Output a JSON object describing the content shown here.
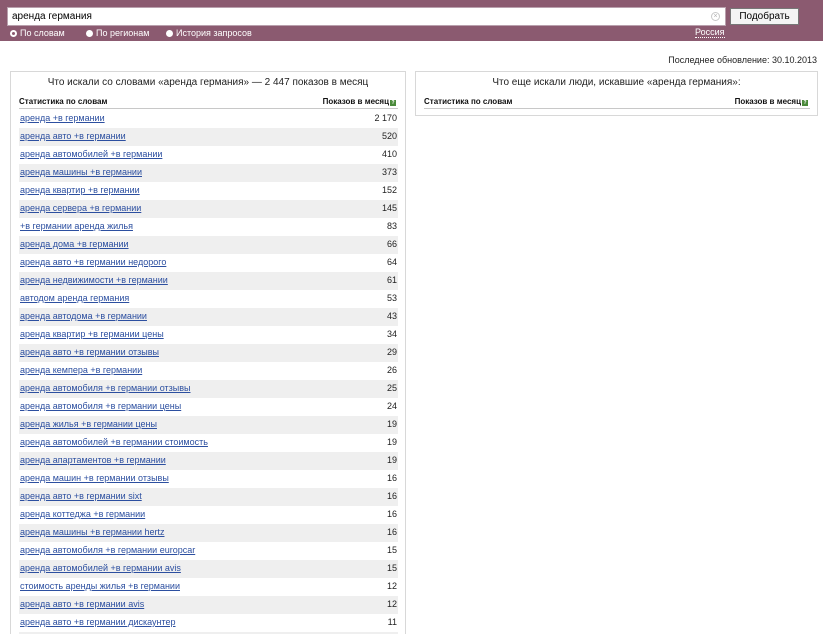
{
  "search": {
    "query": "аренда германия",
    "clear_symbol": "×",
    "button_label": "Подобрать"
  },
  "modes": [
    {
      "label": "По словам",
      "selected": true
    },
    {
      "label": "По регионам",
      "selected": false
    },
    {
      "label": "История запросов",
      "selected": false
    }
  ],
  "region": "Россия",
  "last_update": "Последнее обновление: 30.10.2013",
  "left_panel": {
    "title": "Что искали со словами «аренда германия» — 2 447 показов в месяц",
    "col_stats": "Статистика по словам",
    "col_shows": "Показов в месяц",
    "help_mark": "?",
    "rows": [
      {
        "keyword": "аренда +в германии",
        "count": "2 170"
      },
      {
        "keyword": "аренда авто +в германии",
        "count": "520"
      },
      {
        "keyword": "аренда автомобилей +в германии",
        "count": "410"
      },
      {
        "keyword": "аренда машины +в германии",
        "count": "373"
      },
      {
        "keyword": "аренда квартир +в германии",
        "count": "152"
      },
      {
        "keyword": "аренда сервера +в германии",
        "count": "145"
      },
      {
        "keyword": "+в германии аренда жилья",
        "count": "83"
      },
      {
        "keyword": "аренда дома +в германии",
        "count": "66"
      },
      {
        "keyword": "аренда авто +в германии недорого",
        "count": "64"
      },
      {
        "keyword": "аренда недвижимости +в германии",
        "count": "61"
      },
      {
        "keyword": "автодом аренда германия",
        "count": "53"
      },
      {
        "keyword": "аренда автодома +в германии",
        "count": "43"
      },
      {
        "keyword": "аренда квартир +в германии цены",
        "count": "34"
      },
      {
        "keyword": "аренда авто +в германии отзывы",
        "count": "29"
      },
      {
        "keyword": "аренда кемпера +в германии",
        "count": "26"
      },
      {
        "keyword": "аренда автомобиля +в германии отзывы",
        "count": "25"
      },
      {
        "keyword": "аренда автомобиля +в германии цены",
        "count": "24"
      },
      {
        "keyword": "аренда жилья +в германии цены",
        "count": "19"
      },
      {
        "keyword": "аренда автомобилей +в германии стоимость",
        "count": "19"
      },
      {
        "keyword": "аренда апартаментов +в германии",
        "count": "19"
      },
      {
        "keyword": "аренда машин +в германии отзывы",
        "count": "16"
      },
      {
        "keyword": "аренда авто +в германии sixt",
        "count": "16"
      },
      {
        "keyword": "аренда коттеджа +в германии",
        "count": "16"
      },
      {
        "keyword": "аренда машины +в германии hertz",
        "count": "16"
      },
      {
        "keyword": "аренда автомобиля +в германии europcar",
        "count": "15"
      },
      {
        "keyword": "аренда автомобилей +в германии avis",
        "count": "15"
      },
      {
        "keyword": "стоимость аренды жилья +в германии",
        "count": "12"
      },
      {
        "keyword": "аренда авто +в германии avis",
        "count": "12"
      },
      {
        "keyword": "аренда авто +в германии дискаунтер",
        "count": "11"
      },
      {
        "keyword": "",
        "count": ""
      }
    ]
  },
  "right_panel": {
    "title": "Что еще искали люди, искавшие «аренда германия»:",
    "col_stats": "Статистика по словам",
    "col_shows": "Показов в месяц",
    "help_mark": "?"
  }
}
